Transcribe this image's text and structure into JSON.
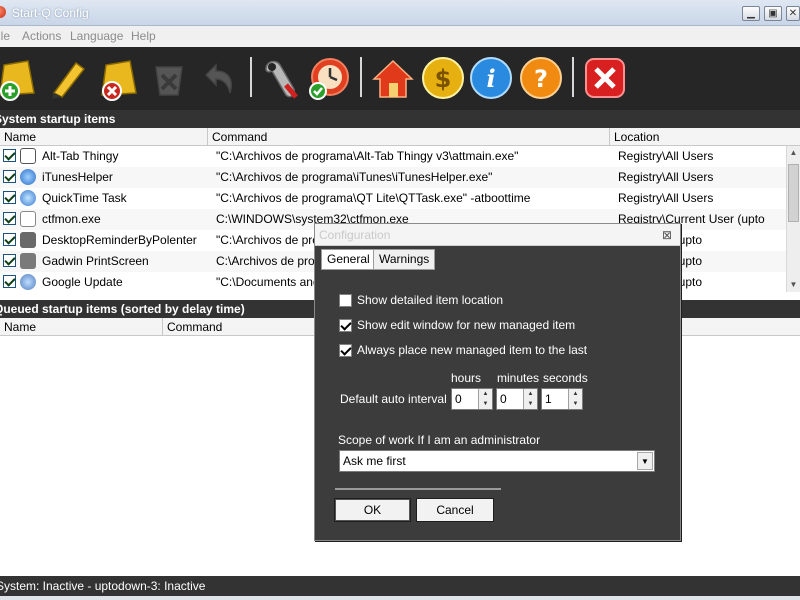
{
  "window": {
    "title": "Start-Q Config",
    "buttons": [
      "minimize",
      "maximize",
      "close"
    ]
  },
  "menu": {
    "items": [
      "ile",
      "Actions",
      "Language",
      "Help"
    ]
  },
  "toolbar": {
    "icons": [
      "add-item-icon",
      "edit-item-icon",
      "remove-item-icon",
      "clear-icon",
      "undo-icon",
      "settings-icon",
      "schedule-icon",
      "home-icon",
      "donate-icon",
      "info-icon",
      "help-icon",
      "exit-icon"
    ]
  },
  "system_items": {
    "header": "System startup items",
    "columns": [
      "Name",
      "Command",
      "Location"
    ],
    "rows": [
      {
        "name": "Alt-Tab Thingy",
        "command": "\"C:\\Archivos de programa\\Alt-Tab Thingy v3\\attmain.exe\"",
        "location": "Registry\\All Users",
        "icon": "alt-tab-icon"
      },
      {
        "name": "iTunesHelper",
        "command": "\"C:\\Archivos de programa\\iTunes\\iTunesHelper.exe\"",
        "location": "Registry\\All Users",
        "icon": "itunes-icon"
      },
      {
        "name": "QuickTime Task",
        "command": "\"C:\\Archivos de programa\\QT Lite\\QTTask.exe\" -atboottime",
        "location": "Registry\\All Users",
        "icon": "quicktime-icon"
      },
      {
        "name": "ctfmon.exe",
        "command": "C:\\WINDOWS\\system32\\ctfmon.exe",
        "location": "Registry\\Current User (upto",
        "icon": "ctfmon-icon"
      },
      {
        "name": "DesktopReminderByPolenter",
        "command": "\"C:\\Archivos de progra",
        "location": "rrent User (upto",
        "icon": "reminder-icon"
      },
      {
        "name": "Gadwin PrintScreen",
        "command": "C:\\Archivos de progra",
        "location": "rrent User (upto",
        "icon": "printscreen-icon"
      },
      {
        "name": "Google Update",
        "command": "\"C:\\Documents and",
        "location": "rrent User (upto",
        "icon": "google-update-icon"
      }
    ]
  },
  "queued_items": {
    "header": "Queued startup items (sorted by delay time)",
    "columns": [
      "Name",
      "Command"
    ]
  },
  "status": {
    "text": "System: Inactive - uptodown-3: Inactive"
  },
  "dialog": {
    "title": "Configuration",
    "close_glyph": "⊠",
    "tabs": [
      "General",
      "Warnings"
    ],
    "active_tab": "General",
    "options": [
      {
        "label": "Show detailed item location",
        "checked": false
      },
      {
        "label": "Show edit window for new managed item",
        "checked": true
      },
      {
        "label": "Always place new managed item to the last",
        "checked": true
      }
    ],
    "interval": {
      "label": "Default auto interval",
      "hours_label": "hours",
      "hours": "0",
      "minutes_label": "minutes",
      "minutes": "0",
      "seconds_label": "seconds",
      "seconds": "1"
    },
    "scope": {
      "label": "Scope of work If I am an administrator",
      "value": "Ask me first"
    },
    "ok_label": "OK",
    "cancel_label": "Cancel"
  }
}
